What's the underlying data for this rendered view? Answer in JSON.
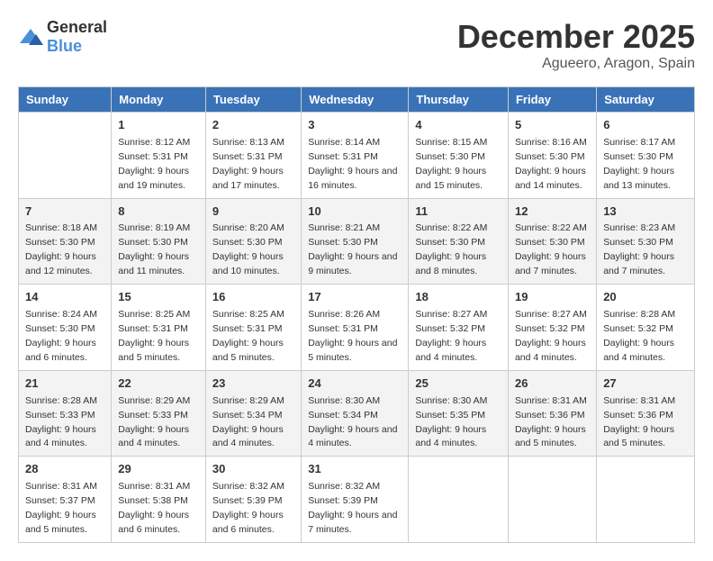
{
  "logo": {
    "general": "General",
    "blue": "Blue"
  },
  "title": "December 2025",
  "subtitle": "Agueero, Aragon, Spain",
  "days": [
    "Sunday",
    "Monday",
    "Tuesday",
    "Wednesday",
    "Thursday",
    "Friday",
    "Saturday"
  ],
  "weeks": [
    [
      {
        "date": "",
        "sunrise": "",
        "sunset": "",
        "daylight": ""
      },
      {
        "date": "1",
        "sunrise": "Sunrise: 8:12 AM",
        "sunset": "Sunset: 5:31 PM",
        "daylight": "Daylight: 9 hours and 19 minutes."
      },
      {
        "date": "2",
        "sunrise": "Sunrise: 8:13 AM",
        "sunset": "Sunset: 5:31 PM",
        "daylight": "Daylight: 9 hours and 17 minutes."
      },
      {
        "date": "3",
        "sunrise": "Sunrise: 8:14 AM",
        "sunset": "Sunset: 5:31 PM",
        "daylight": "Daylight: 9 hours and 16 minutes."
      },
      {
        "date": "4",
        "sunrise": "Sunrise: 8:15 AM",
        "sunset": "Sunset: 5:30 PM",
        "daylight": "Daylight: 9 hours and 15 minutes."
      },
      {
        "date": "5",
        "sunrise": "Sunrise: 8:16 AM",
        "sunset": "Sunset: 5:30 PM",
        "daylight": "Daylight: 9 hours and 14 minutes."
      },
      {
        "date": "6",
        "sunrise": "Sunrise: 8:17 AM",
        "sunset": "Sunset: 5:30 PM",
        "daylight": "Daylight: 9 hours and 13 minutes."
      }
    ],
    [
      {
        "date": "7",
        "sunrise": "Sunrise: 8:18 AM",
        "sunset": "Sunset: 5:30 PM",
        "daylight": "Daylight: 9 hours and 12 minutes."
      },
      {
        "date": "8",
        "sunrise": "Sunrise: 8:19 AM",
        "sunset": "Sunset: 5:30 PM",
        "daylight": "Daylight: 9 hours and 11 minutes."
      },
      {
        "date": "9",
        "sunrise": "Sunrise: 8:20 AM",
        "sunset": "Sunset: 5:30 PM",
        "daylight": "Daylight: 9 hours and 10 minutes."
      },
      {
        "date": "10",
        "sunrise": "Sunrise: 8:21 AM",
        "sunset": "Sunset: 5:30 PM",
        "daylight": "Daylight: 9 hours and 9 minutes."
      },
      {
        "date": "11",
        "sunrise": "Sunrise: 8:22 AM",
        "sunset": "Sunset: 5:30 PM",
        "daylight": "Daylight: 9 hours and 8 minutes."
      },
      {
        "date": "12",
        "sunrise": "Sunrise: 8:22 AM",
        "sunset": "Sunset: 5:30 PM",
        "daylight": "Daylight: 9 hours and 7 minutes."
      },
      {
        "date": "13",
        "sunrise": "Sunrise: 8:23 AM",
        "sunset": "Sunset: 5:30 PM",
        "daylight": "Daylight: 9 hours and 7 minutes."
      }
    ],
    [
      {
        "date": "14",
        "sunrise": "Sunrise: 8:24 AM",
        "sunset": "Sunset: 5:30 PM",
        "daylight": "Daylight: 9 hours and 6 minutes."
      },
      {
        "date": "15",
        "sunrise": "Sunrise: 8:25 AM",
        "sunset": "Sunset: 5:31 PM",
        "daylight": "Daylight: 9 hours and 5 minutes."
      },
      {
        "date": "16",
        "sunrise": "Sunrise: 8:25 AM",
        "sunset": "Sunset: 5:31 PM",
        "daylight": "Daylight: 9 hours and 5 minutes."
      },
      {
        "date": "17",
        "sunrise": "Sunrise: 8:26 AM",
        "sunset": "Sunset: 5:31 PM",
        "daylight": "Daylight: 9 hours and 5 minutes."
      },
      {
        "date": "18",
        "sunrise": "Sunrise: 8:27 AM",
        "sunset": "Sunset: 5:32 PM",
        "daylight": "Daylight: 9 hours and 4 minutes."
      },
      {
        "date": "19",
        "sunrise": "Sunrise: 8:27 AM",
        "sunset": "Sunset: 5:32 PM",
        "daylight": "Daylight: 9 hours and 4 minutes."
      },
      {
        "date": "20",
        "sunrise": "Sunrise: 8:28 AM",
        "sunset": "Sunset: 5:32 PM",
        "daylight": "Daylight: 9 hours and 4 minutes."
      }
    ],
    [
      {
        "date": "21",
        "sunrise": "Sunrise: 8:28 AM",
        "sunset": "Sunset: 5:33 PM",
        "daylight": "Daylight: 9 hours and 4 minutes."
      },
      {
        "date": "22",
        "sunrise": "Sunrise: 8:29 AM",
        "sunset": "Sunset: 5:33 PM",
        "daylight": "Daylight: 9 hours and 4 minutes."
      },
      {
        "date": "23",
        "sunrise": "Sunrise: 8:29 AM",
        "sunset": "Sunset: 5:34 PM",
        "daylight": "Daylight: 9 hours and 4 minutes."
      },
      {
        "date": "24",
        "sunrise": "Sunrise: 8:30 AM",
        "sunset": "Sunset: 5:34 PM",
        "daylight": "Daylight: 9 hours and 4 minutes."
      },
      {
        "date": "25",
        "sunrise": "Sunrise: 8:30 AM",
        "sunset": "Sunset: 5:35 PM",
        "daylight": "Daylight: 9 hours and 4 minutes."
      },
      {
        "date": "26",
        "sunrise": "Sunrise: 8:31 AM",
        "sunset": "Sunset: 5:36 PM",
        "daylight": "Daylight: 9 hours and 5 minutes."
      },
      {
        "date": "27",
        "sunrise": "Sunrise: 8:31 AM",
        "sunset": "Sunset: 5:36 PM",
        "daylight": "Daylight: 9 hours and 5 minutes."
      }
    ],
    [
      {
        "date": "28",
        "sunrise": "Sunrise: 8:31 AM",
        "sunset": "Sunset: 5:37 PM",
        "daylight": "Daylight: 9 hours and 5 minutes."
      },
      {
        "date": "29",
        "sunrise": "Sunrise: 8:31 AM",
        "sunset": "Sunset: 5:38 PM",
        "daylight": "Daylight: 9 hours and 6 minutes."
      },
      {
        "date": "30",
        "sunrise": "Sunrise: 8:32 AM",
        "sunset": "Sunset: 5:39 PM",
        "daylight": "Daylight: 9 hours and 6 minutes."
      },
      {
        "date": "31",
        "sunrise": "Sunrise: 8:32 AM",
        "sunset": "Sunset: 5:39 PM",
        "daylight": "Daylight: 9 hours and 7 minutes."
      },
      {
        "date": "",
        "sunrise": "",
        "sunset": "",
        "daylight": ""
      },
      {
        "date": "",
        "sunrise": "",
        "sunset": "",
        "daylight": ""
      },
      {
        "date": "",
        "sunrise": "",
        "sunset": "",
        "daylight": ""
      }
    ]
  ]
}
